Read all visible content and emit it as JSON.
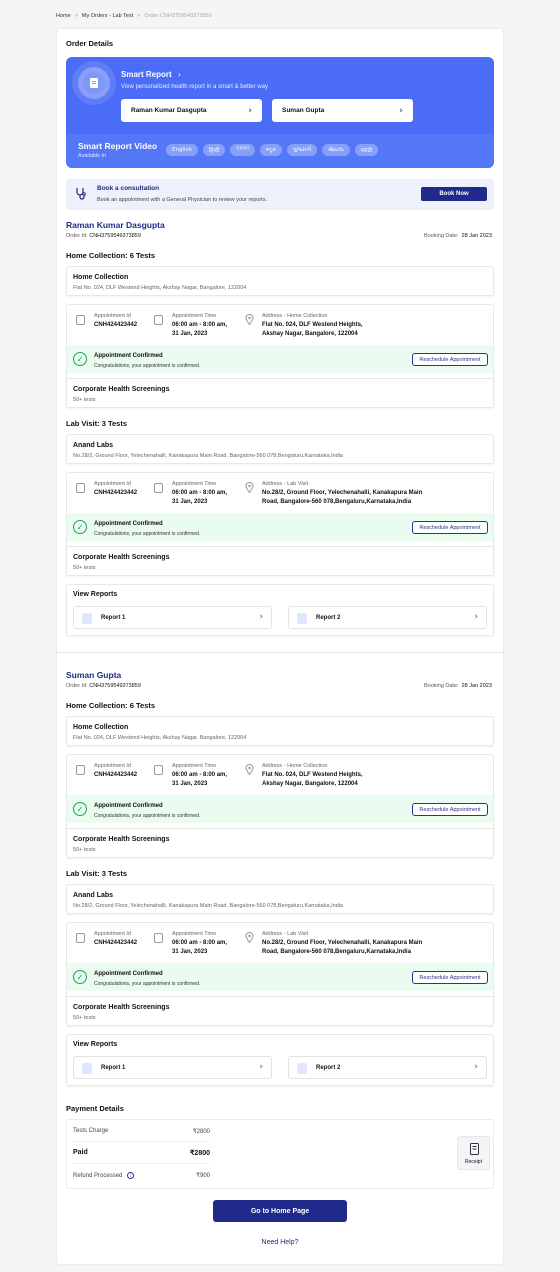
{
  "breadcrumb": {
    "home": "Home",
    "orders": "My Orders - Lab Test",
    "current": "Order CNH3759549373859"
  },
  "page_title": "Order Details",
  "smart_report": {
    "title": "Smart Report",
    "subtitle": "View personalized health report in a smart & better way",
    "patients": [
      "Raman Kumar Dasgupta",
      "Suman Gupta"
    ],
    "video_title": "Smart Report Video",
    "video_sub": "Available in",
    "languages": [
      "English",
      "हिन्दी",
      "বাংলা",
      "ಕನ್ನಡ",
      "ગુજરાતી",
      "తెలుగు",
      "मराठी"
    ]
  },
  "consult": {
    "title": "Book a consultation",
    "subtitle": "Book an appointment with a General Physician to review your reports.",
    "button": "Book Now"
  },
  "labels": {
    "order_id": "Order Id:",
    "booking_date": "Booking Date:",
    "appointment_id": "Appointment Id",
    "appointment_time": "Appointment Time",
    "address_home": "Address - Home Collection",
    "address_lab": "Address - Lab Visit",
    "confirmed": "Appointment Confirmed",
    "confirmed_sub": "Congratulations, your appointment is confirmed.",
    "reschedule": "Reschedule Appointment",
    "view_reports": "View Reports"
  },
  "patients": [
    {
      "name": "Raman Kumar Dasgupta",
      "order_id": "CNH3759549373859",
      "booking_date": "28 Jan 2023",
      "home_section": "Home Collection: 6 Tests",
      "home_title": "Home Collection",
      "home_address": "Flat No. 024, DLF Westend Heights, Akshay Nagar, Bangalore, 122004",
      "home_appt_id": "CNH424423442",
      "home_time1": "06:00 am - 8:00 am,",
      "home_time2": "31 Jan, 2023",
      "home_addr1": "Flat No. 024, DLF Westend Heights,",
      "home_addr2": "Akshay Nagar, Bangalore, 122004",
      "screen_title": "Corporate Health Screenings",
      "screen_sub": "50+ tests",
      "lab_section": "Lab Visit: 3 Tests",
      "lab_title": "Anand Labs",
      "lab_address": "No.28/2, Ground Floor, Yelechenahalli, Kanakapura Main Road, Bangalore-560 078,Bengaluru,Karnataka,India",
      "lab_appt_id": "CNH424423442",
      "lab_time1": "06:00 am - 8:00 am,",
      "lab_time2": "31 Jan, 2023",
      "lab_addr1": "No.28/2, Ground Floor, Yelechenahalli, Kanakapura Main",
      "lab_addr2": "Road, Bangalore-560 078,Bengaluru,Karnataka,India",
      "reports": [
        "Report 1",
        "Report 2"
      ]
    },
    {
      "name": "Suman Gupta",
      "order_id": "CNH3759549373859",
      "booking_date": "28 Jan 2023",
      "home_section": "Home Collection: 6 Tests",
      "home_title": "Home Collection",
      "home_address": "Flat No. 024, DLF Westend Heights, Akshay Nagar, Bangalore, 122004",
      "home_appt_id": "CNH424423442",
      "home_time1": "06:00 am - 8:00 am,",
      "home_time2": "31 Jan, 2023",
      "home_addr1": "Flat No. 024, DLF Westend Heights,",
      "home_addr2": "Akshay Nagar, Bangalore, 122004",
      "screen_title": "Corporate Health Screenings",
      "screen_sub": "50+ tests",
      "lab_section": "Lab Visit: 3 Tests",
      "lab_title": "Anand Labs",
      "lab_address": "No.28/2, Ground Floor, Yelechenahalli, Kanakapura Main Road, Bangalore-560 078,Bengaluru,Karnataka,India",
      "lab_appt_id": "CNH424423442",
      "lab_time1": "06:00 am - 8:00 am,",
      "lab_time2": "31 Jan, 2023",
      "lab_addr1": "No.28/2, Ground Floor, Yelechenahalli, Kanakapura Main",
      "lab_addr2": "Road, Bangalore-560 078,Bengaluru,Karnataka,India",
      "reports": [
        "Report 1",
        "Report 2"
      ]
    }
  ],
  "payment": {
    "title": "Payment Details",
    "tests_charge_label": "Tests Charge",
    "tests_charge": "₹2800",
    "paid_label": "Paid",
    "paid": "₹2800",
    "refund_label": "Refund Processed",
    "refund": "₹900",
    "receipt": "Receipt"
  },
  "go_home": "Go to Home Page",
  "need_help": "Need Help?"
}
